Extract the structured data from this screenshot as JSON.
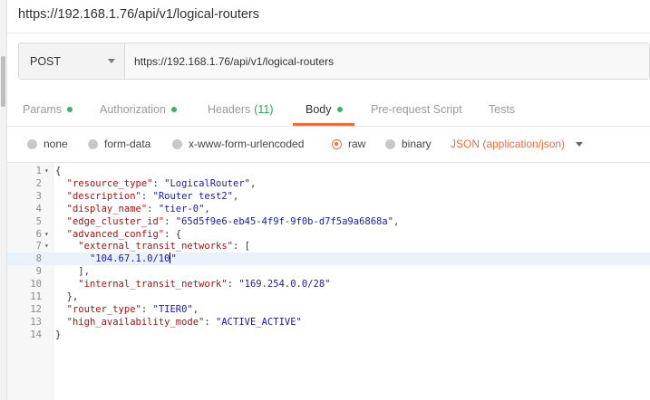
{
  "title": "https://192.168.1.76/api/v1/logical-routers",
  "request": {
    "method": "POST",
    "url": "https://192.168.1.76/api/v1/logical-routers"
  },
  "tabs": [
    {
      "label": "Params",
      "dot": true
    },
    {
      "label": "Authorization",
      "dot": true
    },
    {
      "label": "Headers",
      "count": "(11)"
    },
    {
      "label": "Body",
      "dot": true,
      "active": true
    },
    {
      "label": "Pre-request Script"
    },
    {
      "label": "Tests"
    }
  ],
  "body_modes": {
    "options": [
      "none",
      "form-data",
      "x-www-form-urlencoded",
      "raw",
      "binary"
    ],
    "selected": "raw",
    "content_type": "JSON (application/json)"
  },
  "editor": {
    "highlighted_line": 8,
    "lines": [
      {
        "n": "1",
        "fold": true,
        "text": "{"
      },
      {
        "n": "2",
        "text": "  \"resource_type\": \"LogicalRouter\","
      },
      {
        "n": "3",
        "text": "  \"description\": \"Router test2\","
      },
      {
        "n": "4",
        "text": "  \"display_name\": \"tier-0\","
      },
      {
        "n": "5",
        "text": "  \"edge_cluster_id\": \"65d5f9e6-eb45-4f9f-9f0b-d7f5a9a6868a\","
      },
      {
        "n": "6",
        "fold": true,
        "text": "  \"advanced_config\": {"
      },
      {
        "n": "7",
        "fold": true,
        "text": "    \"external_transit_networks\": ["
      },
      {
        "n": "8",
        "text": "      \"104.67.1.0/10\""
      },
      {
        "n": "9",
        "text": "    ],"
      },
      {
        "n": "10",
        "text": "    \"internal_transit_network\": \"169.254.0.0/28\""
      },
      {
        "n": "11",
        "text": "  },"
      },
      {
        "n": "12",
        "text": "  \"router_type\": \"TIER0\","
      },
      {
        "n": "13",
        "text": "  \"high_availability_mode\": \"ACTIVE_ACTIVE\""
      },
      {
        "n": "14",
        "text": "}"
      }
    ]
  },
  "colors": {
    "accent": "#f26b3a",
    "status_dot": "#3bb36a",
    "json_key": "#aa1111",
    "json_string": "#1a1aa6",
    "highlight_line": "#e8f2fb"
  }
}
